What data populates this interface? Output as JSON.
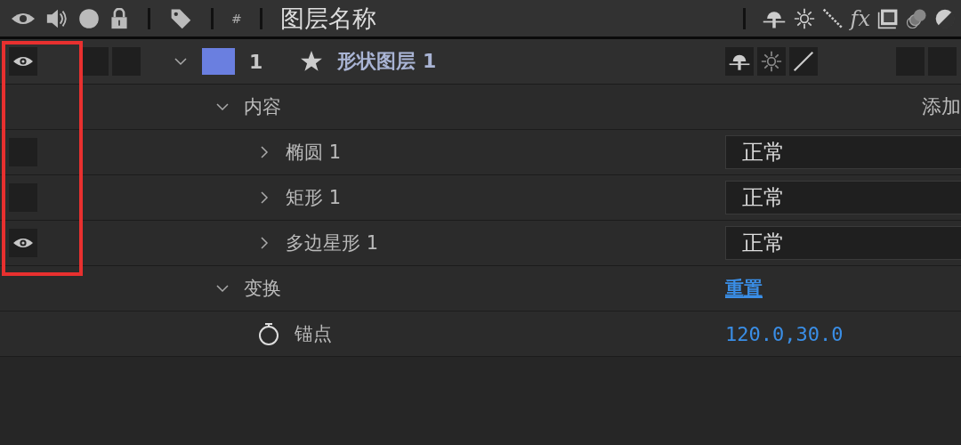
{
  "header": {
    "label_column": "#",
    "name_column": "图层名称",
    "effects_switch": "fx"
  },
  "layer": {
    "number": "1",
    "name": "形状图层 1",
    "color": "#6a7fe0",
    "visible": true,
    "audio": false,
    "solo": false,
    "shy": true,
    "collapse": false,
    "quality": true,
    "expanded": true,
    "children": [
      {
        "kind": "group",
        "name": "内容",
        "expanded": true,
        "action": "添加",
        "children": [
          {
            "kind": "shape",
            "name": "椭圆 1",
            "visible": false,
            "expanded": false,
            "blend_mode": "正常"
          },
          {
            "kind": "shape",
            "name": "矩形 1",
            "visible": false,
            "expanded": false,
            "blend_mode": "正常"
          },
          {
            "kind": "shape",
            "name": "多边星形 1",
            "visible": true,
            "expanded": false,
            "blend_mode": "正常"
          }
        ]
      },
      {
        "kind": "group",
        "name": "变换",
        "expanded": true,
        "link": "重置",
        "children": [
          {
            "kind": "property",
            "name": "锚点",
            "value": "120.0,30.0"
          }
        ]
      }
    ]
  }
}
